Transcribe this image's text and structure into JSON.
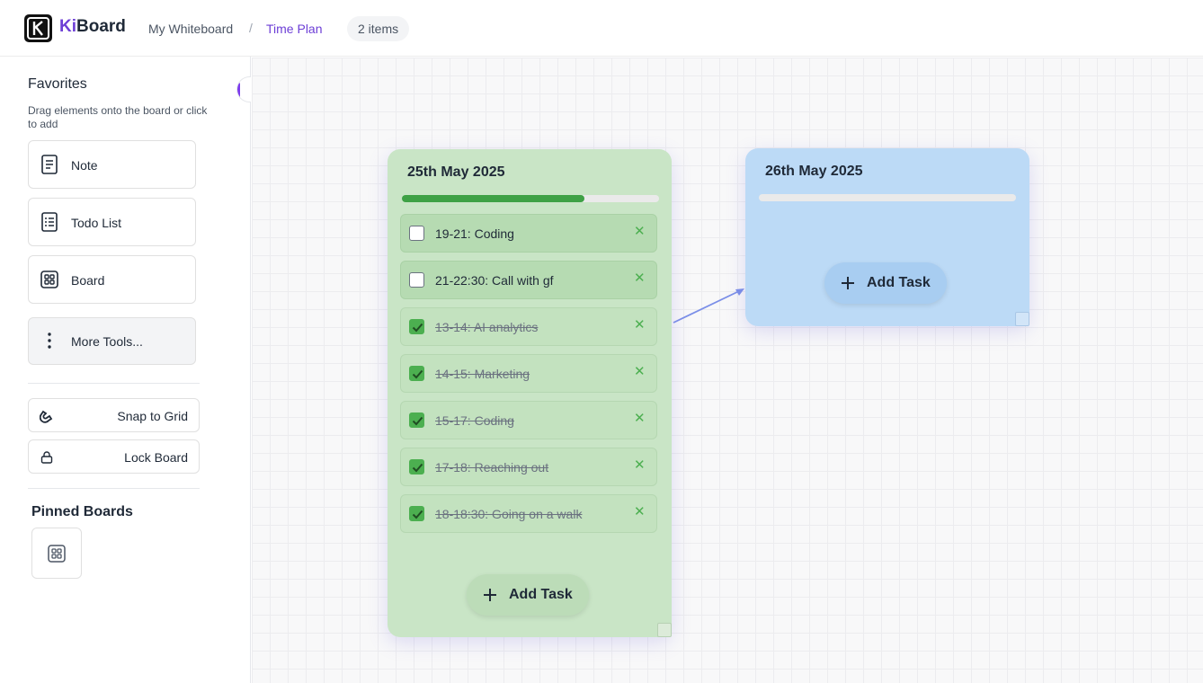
{
  "header": {
    "logo_prefix": "Ki",
    "logo_suffix": "Board",
    "breadcrumb": [
      "My Whiteboard",
      "Time Plan"
    ],
    "breadcrumb_separator": "/",
    "items_badge": "2 items"
  },
  "sidebar": {
    "favorites_title": "Favorites",
    "favorites_hint": "Drag elements onto the board or click to add",
    "tools": [
      {
        "label": "Note",
        "icon": "note-icon"
      },
      {
        "label": "Todo List",
        "icon": "todo-list-icon"
      },
      {
        "label": "Board",
        "icon": "board-icon"
      }
    ],
    "more_tools_label": "More Tools...",
    "snap_to_grid_label": "Snap to Grid",
    "lock_board_label": "Lock Board",
    "pinned_title": "Pinned Boards",
    "pinned_icon": "board-icon"
  },
  "colors": {
    "accent": "#6d3fd6",
    "green_card": "#c9e5c6",
    "blue_card": "#bcdaf6",
    "progress_fill": "#3ea145",
    "connector": "#7b8fe8"
  },
  "cards": [
    {
      "title": "25th May 2025",
      "progress": 0.71,
      "add_task_label": "Add Task",
      "tasks": [
        {
          "text": "19-21: Coding",
          "done": false
        },
        {
          "text": "21-22:30: Call with gf",
          "done": false
        },
        {
          "text": "13-14: AI analytics",
          "done": true
        },
        {
          "text": "14-15: Marketing",
          "done": true
        },
        {
          "text": "15-17: Coding",
          "done": true
        },
        {
          "text": "17-18: Reaching out",
          "done": true
        },
        {
          "text": "18-18:30: Going on a walk",
          "done": true
        }
      ]
    },
    {
      "title": "26th May 2025",
      "progress": 0,
      "add_task_label": "Add Task",
      "tasks": []
    }
  ]
}
